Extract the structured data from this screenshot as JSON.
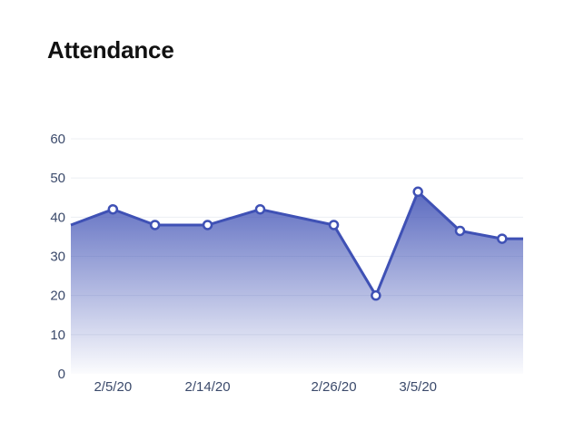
{
  "chart_data": {
    "type": "area",
    "title": "Attendance",
    "xlabel": "",
    "ylabel": "",
    "ylim": [
      0,
      60
    ],
    "y_ticks": [
      0,
      10,
      20,
      30,
      40,
      50,
      60
    ],
    "x_tick_labels": [
      "2/5/20",
      "2/14/20",
      "2/26/20",
      "3/5/20"
    ],
    "grid": true,
    "colors": {
      "line": "#3f51b5",
      "fill_top": "#3f51b5",
      "fill_bottom": "#ffffff",
      "grid": "#eceff3",
      "marker_fill": "#ffffff"
    },
    "x": [
      "2/1/20",
      "2/5/20",
      "2/9/20",
      "2/14/20",
      "2/19/20",
      "2/26/20",
      "3/1/20",
      "3/5/20",
      "3/9/20",
      "3/13/20"
    ],
    "values": [
      38,
      42,
      38,
      38,
      42,
      38,
      20,
      46.5,
      36.5,
      34.5
    ],
    "markers_shown": [
      false,
      true,
      true,
      true,
      true,
      true,
      true,
      true,
      true,
      true
    ]
  }
}
